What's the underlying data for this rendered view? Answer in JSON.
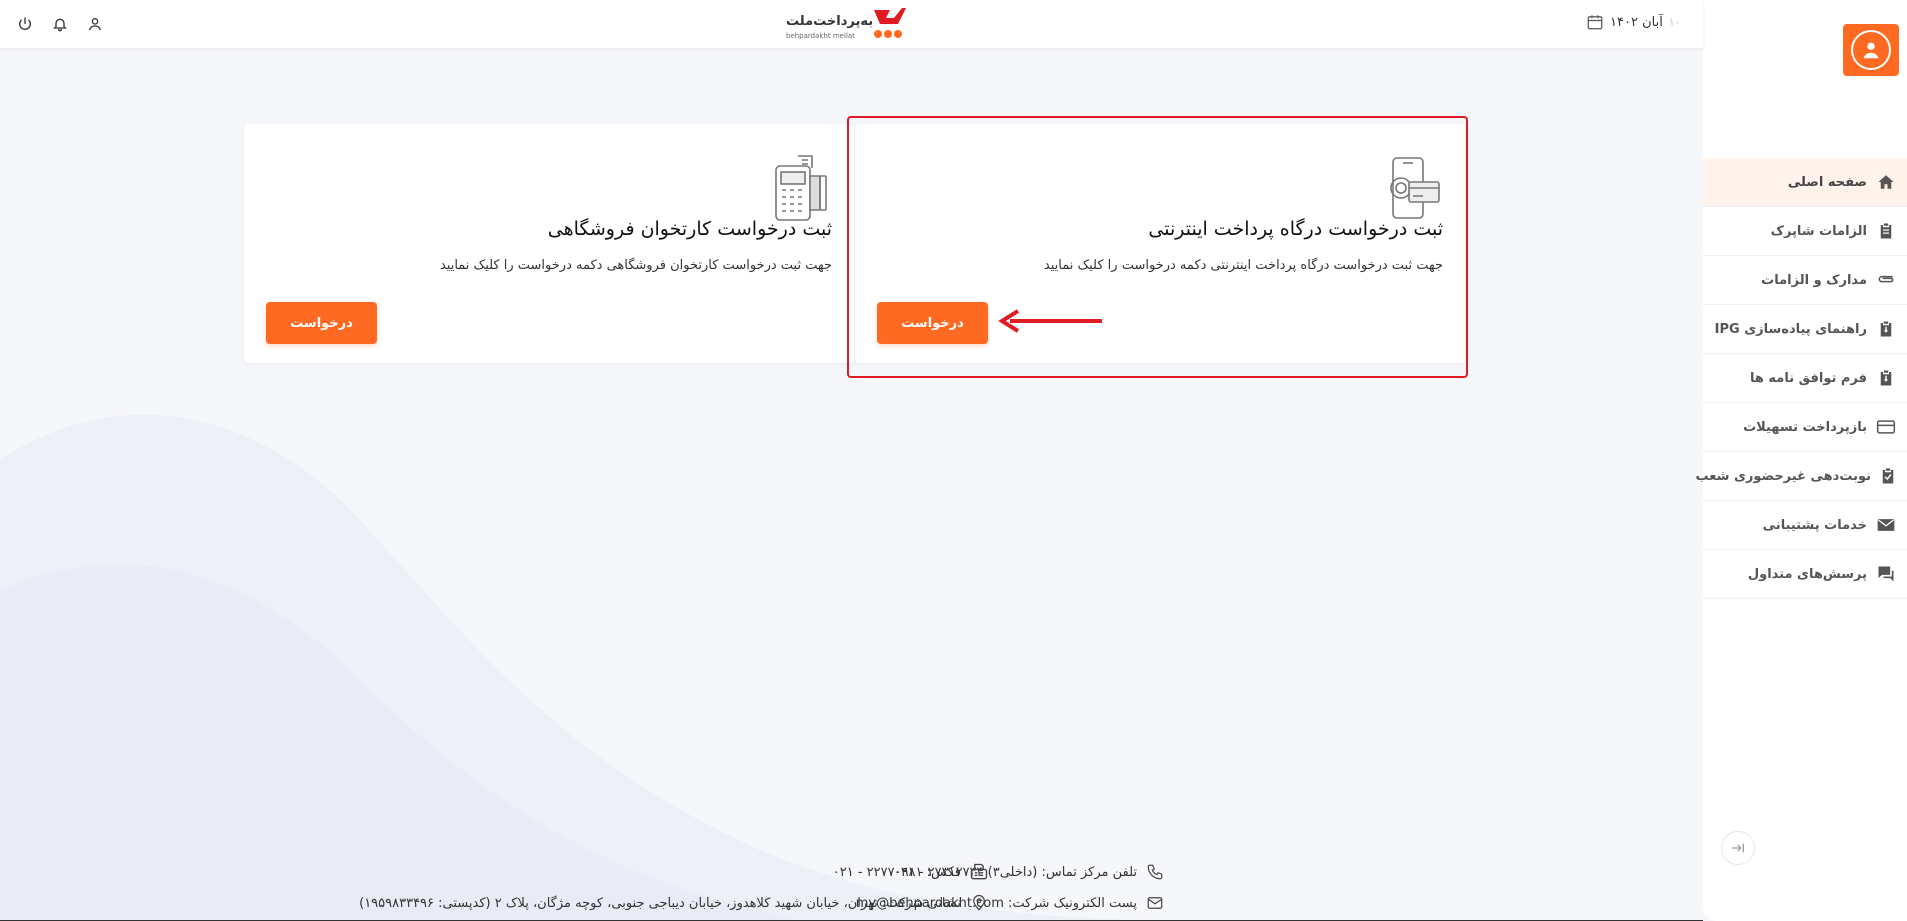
{
  "header": {
    "logo_text": "به‌پرداخت‌ملت",
    "logo_sub": "behpardakht mellat",
    "date_text": "آبان ۱۴۰۲",
    "date_muted": "۱۰"
  },
  "sidebar": {
    "items": [
      {
        "label": "صفحه اصلی",
        "icon": "home-icon",
        "active": true
      },
      {
        "label": "الزامات شاپرک",
        "icon": "clipboard-icon",
        "active": false
      },
      {
        "label": "مدارک و الزامات",
        "icon": "paperclip-icon",
        "active": false
      },
      {
        "label": "راهنمای پیاده‌سازی IPG",
        "icon": "download-clipboard-icon",
        "active": false
      },
      {
        "label": "فرم توافق نامه ها",
        "icon": "download-clipboard-icon",
        "active": false
      },
      {
        "label": "بازپرداخت تسهیلات",
        "icon": "credit-card-icon",
        "active": false
      },
      {
        "label": "نوبت‌دهی غیرحضوری شعب",
        "icon": "check-clipboard-icon",
        "active": false
      },
      {
        "label": "خدمات پشتیبانی",
        "icon": "mail-icon",
        "active": false
      },
      {
        "label": "پرسش‌های متداول",
        "icon": "chat-icon",
        "active": false
      }
    ]
  },
  "cards": [
    {
      "title": "ثبت درخواست درگاه پرداخت اینترنتی",
      "desc": "جهت ثبت درخواست درگاه پرداخت اینترنتی دکمه درخواست را کلیک نمایید",
      "button": "درخواست",
      "icon": "mobile-payment-icon"
    },
    {
      "title": "ثبت درخواست کارتخوان فروشگاهی",
      "desc": "جهت ثبت درخواست کارتخوان فروشگاهی دکمه درخواست را کلیک نمایید",
      "button": "درخواست",
      "icon": "pos-terminal-icon"
    }
  ],
  "footer": {
    "phone": "تلفن مرکز تماس: (داخلی۳) ۲۷۳۱۲۷۳۴ - ۰۲۱",
    "fax": "فکس: ۲۲۷۷۰۹۸۱ - ۰۲۱",
    "email": "پست الکترونیک شرکت: my@behpardakht.com",
    "address": "نشانی شرکت: تهران، خیابان شهید کلاهدوز، خیابان دیباجی جنوبی، کوچه مژگان، پلاک ۲ (کدپستی: ۱۹۵۹۸۳۳۴۹۶)"
  },
  "colors": {
    "accent": "#ff6a22",
    "highlight": "#e01b24",
    "active_bg": "#fff3ec"
  }
}
